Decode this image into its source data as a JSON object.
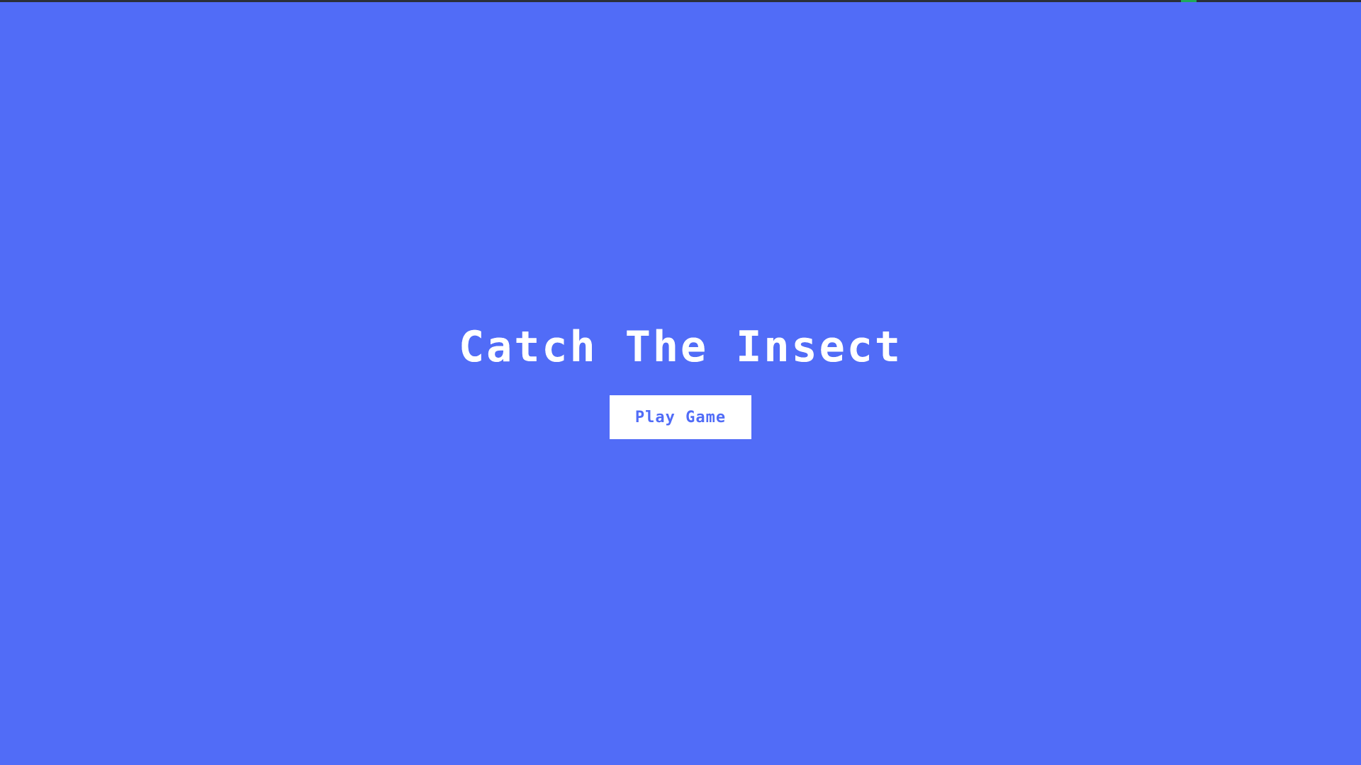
{
  "game": {
    "title": "Catch The Insect",
    "play_button_label": "Play Game"
  },
  "colors": {
    "background": "#516cf7",
    "text": "#ffffff",
    "button_bg": "#ffffff",
    "button_text": "#516cf7"
  }
}
